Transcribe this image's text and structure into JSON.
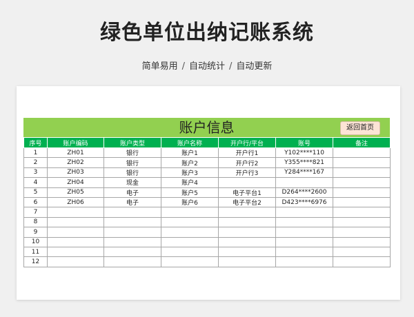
{
  "header": {
    "title": "绿色单位出纳记账系统",
    "subtitle_parts": [
      "简单易用",
      "自动统计",
      "自动更新"
    ],
    "separator": "/"
  },
  "sheet": {
    "banner_title": "账户信息",
    "home_button_label": "返回首页",
    "columns": [
      "序号",
      "账户编码",
      "账户类型",
      "账户名称",
      "开户行/平台",
      "账号",
      "备注"
    ],
    "rows": [
      [
        "1",
        "ZH01",
        "银行",
        "账户1",
        "开户行1",
        "Y102****110",
        ""
      ],
      [
        "2",
        "ZH02",
        "银行",
        "账户2",
        "开户行2",
        "Y355****821",
        ""
      ],
      [
        "3",
        "ZH03",
        "银行",
        "账户3",
        "开户行3",
        "Y284****167",
        ""
      ],
      [
        "4",
        "ZH04",
        "现金",
        "账户4",
        "",
        "",
        ""
      ],
      [
        "5",
        "ZH05",
        "电子",
        "账户5",
        "电子平台1",
        "D264****2600",
        ""
      ],
      [
        "6",
        "ZH06",
        "电子",
        "账户6",
        "电子平台2",
        "D423****6976",
        ""
      ],
      [
        "7",
        "",
        "",
        "",
        "",
        "",
        ""
      ],
      [
        "8",
        "",
        "",
        "",
        "",
        "",
        ""
      ],
      [
        "9",
        "",
        "",
        "",
        "",
        "",
        ""
      ],
      [
        "10",
        "",
        "",
        "",
        "",
        "",
        ""
      ],
      [
        "11",
        "",
        "",
        "",
        "",
        "",
        ""
      ],
      [
        "12",
        "",
        "",
        "",
        "",
        "",
        ""
      ]
    ]
  },
  "colors": {
    "banner": "#92d050",
    "header_row": "#00b050",
    "home_button": "#fce4d6"
  }
}
